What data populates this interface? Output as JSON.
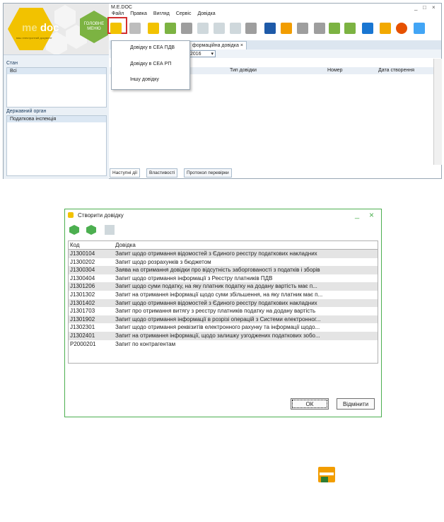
{
  "app": {
    "window_title": "M.E.DOC",
    "logo_text_me": "me",
    "logo_text_doc": "doc",
    "logo_subtitle": "ваш електронний документ",
    "main_menu_label": "ГОЛОВНЕ МЕНЮ",
    "menu": [
      "Файл",
      "Правка",
      "Вигляд",
      "Сервіс",
      "Довідка"
    ],
    "window_controls": [
      "_",
      "□",
      "×"
    ],
    "left_panel": {
      "state_title": "Стан",
      "state_selected": "Всі",
      "org_title": "Державний орган",
      "org_selected": "Податкова інспекція"
    },
    "tab_active": "формаційна довідка",
    "tab_close": "×",
    "year": "2016",
    "grid_columns": [
      "Тип довідки",
      "Номер",
      "Дата створення"
    ],
    "bottom_tabs": [
      "Наступні дії",
      "Властивості",
      "Протокол перевірки"
    ],
    "dropdown_items": [
      "Довідку в СЕА ПДВ",
      "Довідку в СЕА РП",
      "Іншу довідку"
    ]
  },
  "dialog": {
    "title": "Створити довідку",
    "controls": [
      "_",
      "×"
    ],
    "columns": [
      "Код",
      "Довідка"
    ],
    "rows": [
      {
        "code": "J1300104",
        "name": "Запит щодо отримання відомостей з Єдиного реєстру податкових накладних"
      },
      {
        "code": "J1300202",
        "name": "Запит щодо розрахунків з бюджетом"
      },
      {
        "code": "J1300304",
        "name": "Заява на отримання довідки про відсутність заборгованості з податків і зборів"
      },
      {
        "code": "J1300404",
        "name": "Запит щодо отримання інформації з Реєстру платників ПДВ"
      },
      {
        "code": "J1301206",
        "name": "Запит щодо суми податку, на яку платник податку на додану вартість має п..."
      },
      {
        "code": "J1301302",
        "name": "Запит на отримання інформації щодо суми збільшення, на яку платник має п..."
      },
      {
        "code": "J1301402",
        "name": "Запит щодо отримання відомостей з Єдиного реєстру податкових накладних"
      },
      {
        "code": "J1301703",
        "name": "Запит про отримання витягу з реєстру платників податку на додану вартість"
      },
      {
        "code": "J1301902",
        "name": "Запит щодо отримання інформації в розрізі операцій з Системи електронног..."
      },
      {
        "code": "J1302301",
        "name": "Запит щодо отримання реквізитів електронного рахунку та інформації щодо..."
      },
      {
        "code": "J1302401",
        "name": "Запит на отримання інформації, щодо залишку узгоджених податкових зобо..."
      },
      {
        "code": "P2000201",
        "name": "Запит по контрагентам"
      }
    ],
    "ok_label": "ОК",
    "cancel_label": "Відмінити"
  },
  "colors": {
    "brand_yellow": "#f2c200",
    "menu_green": "#7cb342",
    "dialog_border": "#4caf50",
    "highlight_red": "#d32f2f",
    "panel_blue": "#eaf0f6"
  }
}
